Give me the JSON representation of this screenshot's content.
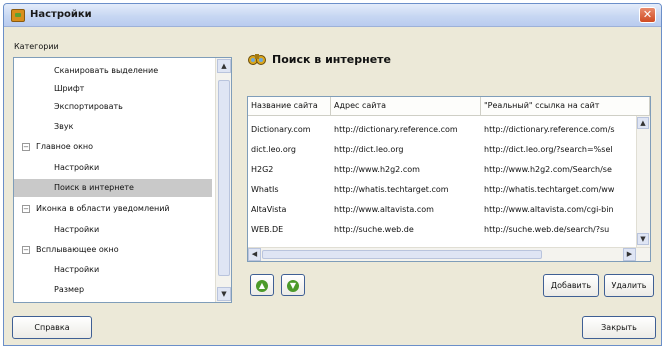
{
  "window": {
    "title": "Настройки"
  },
  "categories": {
    "label": "Категории",
    "items": [
      {
        "label": "Сканировать выделение",
        "type": "child"
      },
      {
        "label": "Шрифт",
        "type": "child"
      },
      {
        "label": "Экспортировать",
        "type": "child"
      },
      {
        "label": "Звук",
        "type": "child"
      },
      {
        "label": "Главное окно",
        "type": "parent"
      },
      {
        "label": "Настройки",
        "type": "child"
      },
      {
        "label": "Поиск в интернете",
        "type": "child",
        "selected": true
      },
      {
        "label": "Иконка в области уведомлений",
        "type": "parent"
      },
      {
        "label": "Настройки",
        "type": "child"
      },
      {
        "label": "Всплывающее окно",
        "type": "parent"
      },
      {
        "label": "Настройки",
        "type": "child"
      },
      {
        "label": "Размер",
        "type": "child"
      }
    ]
  },
  "section": {
    "title": "Поиск в интернете"
  },
  "table": {
    "columns": [
      "Название сайта",
      "Адрес сайта",
      "\"Реальный\" ссылка на сайт"
    ],
    "rows": [
      [
        "Dictionary.com",
        "http://dictionary.reference.com",
        "http://dictionary.reference.com/s"
      ],
      [
        "dict.leo.org",
        "http://dict.leo.org",
        "http://dict.leo.org/?search=%sel"
      ],
      [
        "H2G2",
        "http://www.h2g2.com",
        "http://www.h2g2.com/Search/se"
      ],
      [
        "WhatIs",
        "http://whatis.techtarget.com",
        "http://whatis.techtarget.com/ww"
      ],
      [
        "AltaVista",
        "http://www.altavista.com",
        "http://www.altavista.com/cgi-bin"
      ],
      [
        "WEB.DE",
        "http://suche.web.de",
        "http://suche.web.de/search/?su"
      ]
    ]
  },
  "buttons": {
    "add": "Добавить",
    "delete": "Удалить",
    "help": "Справка",
    "close": "Закрыть"
  }
}
